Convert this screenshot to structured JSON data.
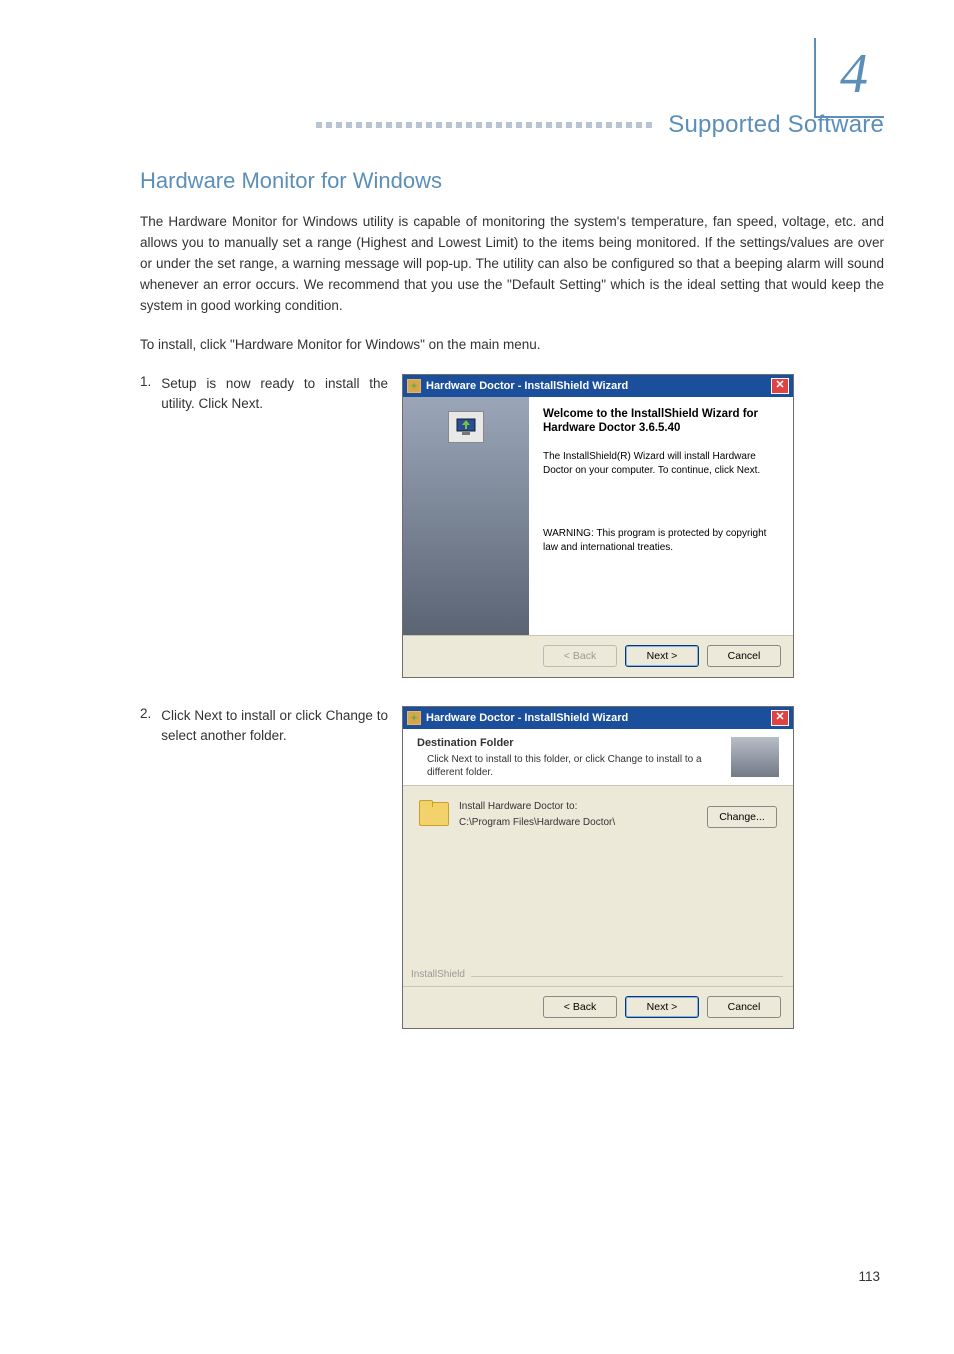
{
  "chapter_number": "4",
  "header_title": "Supported Software",
  "section_title": "Hardware Monitor for Windows",
  "intro_para": "The Hardware Monitor for Windows utility is capable of monitoring the system's temperature, fan speed, voltage, etc. and allows you to manually set a range (Highest and Lowest Limit) to the items being monitored. If the settings/values are over or under the set range, a warning message will pop-up. The utility can also be configured so that a beeping alarm will sound whenever an error occurs. We recommend that you use the \"Default Setting\" which is the ideal setting that would keep the system in good working condition.",
  "install_line": "To install, click \"Hardware Monitor for Windows\" on the main menu.",
  "steps": [
    {
      "num": "1.",
      "text": "Setup is now ready to install the utility. Click Next."
    },
    {
      "num": "2.",
      "text": "Click Next to install or click Change to select another folder."
    }
  ],
  "wizard1": {
    "title": "Hardware Doctor - InstallShield Wizard",
    "heading": "Welcome to the InstallShield Wizard for Hardware Doctor 3.6.5.40",
    "para": "The InstallShield(R) Wizard will install Hardware Doctor on your computer. To continue, click Next.",
    "warning": "WARNING: This program is protected by copyright law and international treaties.",
    "back": "< Back",
    "next": "Next >",
    "cancel": "Cancel"
  },
  "wizard2": {
    "title": "Hardware Doctor - InstallShield Wizard",
    "dest_header": "Destination Folder",
    "dest_sub": "Click Next to install to this folder, or click Change to install to a different folder.",
    "install_to_label": "Install Hardware Doctor to:",
    "install_path": "C:\\Program Files\\Hardware Doctor\\",
    "change": "Change...",
    "brand": "InstallShield",
    "back": "< Back",
    "next": "Next >",
    "cancel": "Cancel"
  },
  "page_number": "113"
}
